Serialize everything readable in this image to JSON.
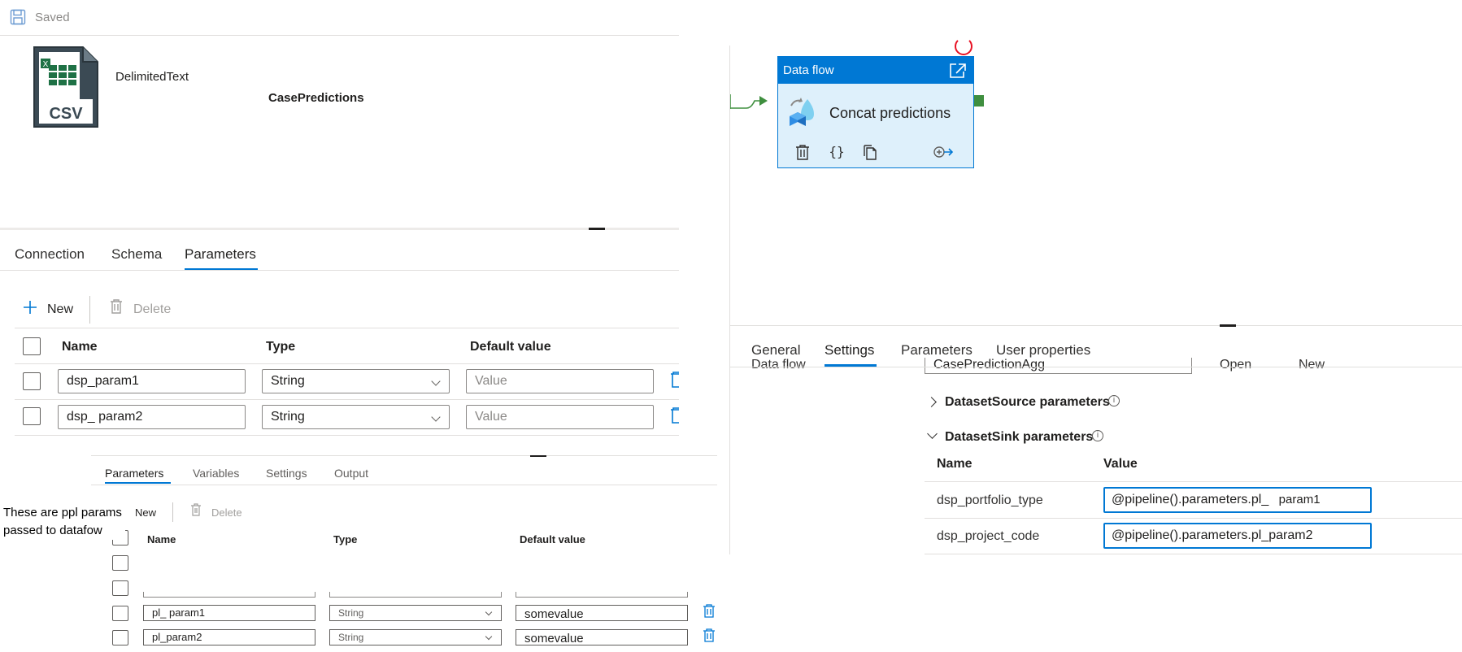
{
  "dataset": {
    "saved_label": "Saved",
    "icon_label": "CSV",
    "type": "DelimitedText",
    "name": "CasePredictions",
    "tabs": [
      {
        "label": "Connection",
        "active": false
      },
      {
        "label": "Schema",
        "active": false
      },
      {
        "label": "Parameters",
        "active": true
      }
    ],
    "toolbar": {
      "new_label": "New",
      "delete_label": "Delete"
    },
    "columns": {
      "name": "Name",
      "type": "Type",
      "default": "Default value"
    },
    "rows": [
      {
        "name": "dsp_param1",
        "type": "String",
        "default_placeholder": "Value"
      },
      {
        "name": "dsp_  param2",
        "type": "String",
        "default_placeholder": "Value"
      }
    ]
  },
  "pipeline_params": {
    "tabs": [
      {
        "label": "Parameters",
        "active": true
      },
      {
        "label": "Variables",
        "active": false
      },
      {
        "label": "Settings",
        "active": false
      },
      {
        "label": "Output",
        "active": false
      }
    ],
    "toolbar": {
      "new_label": "New",
      "delete_label": "Delete"
    },
    "columns": {
      "name": "Name",
      "type": "Type",
      "default": "Default value"
    },
    "rows": [
      {
        "name": "pl_ param1",
        "type": "String",
        "default": "somevalue"
      },
      {
        "name": "pl_param2",
        "type": "String",
        "default": "somevalue"
      }
    ],
    "note": [
      "These are ppl params",
      "passed to datafow"
    ]
  },
  "canvas": {
    "node": {
      "header": "Data flow",
      "name": "Concat predictions"
    }
  },
  "activity_settings": {
    "tabs": [
      {
        "label": "General",
        "active": false
      },
      {
        "label": "Settings",
        "active": true
      },
      {
        "label": "Parameters",
        "active": false
      },
      {
        "label": "User properties",
        "active": false
      }
    ],
    "clipped_row": {
      "label": "Data flow",
      "selected": "CasePredictionAgg",
      "open_label": "Open",
      "new_label": "New"
    },
    "source_section": "DatasetSource parameters",
    "sink_section": "DatasetSink parameters",
    "columns": {
      "name": "Name",
      "value": "Value"
    },
    "sink_rows": [
      {
        "name": "dsp_portfolio_type",
        "value": "@pipeline().parameters.pl_",
        "value_suffix": "param1"
      },
      {
        "name": "dsp_project_code",
        "value": "@pipeline().parameters.pl_param2",
        "value_suffix": ""
      }
    ]
  },
  "colors": {
    "accent": "#0078d4",
    "node_fill": "#def0fb",
    "success": "#3f8f3f",
    "error": "#e81123"
  }
}
